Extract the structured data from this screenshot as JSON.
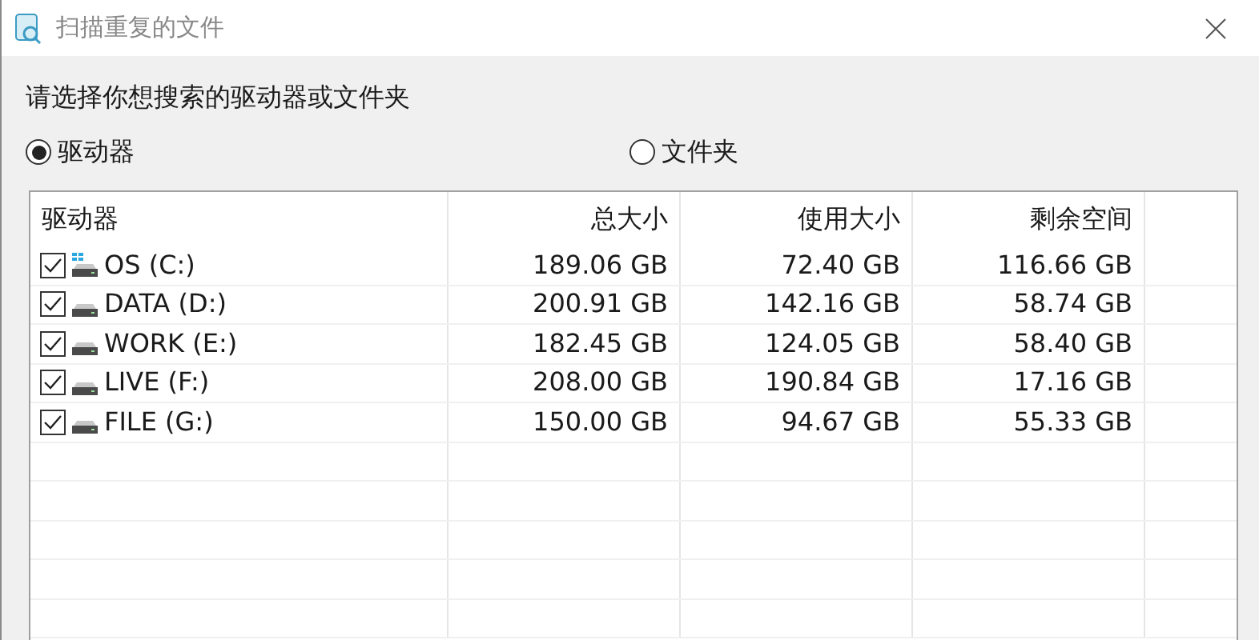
{
  "window": {
    "title": "扫描重复的文件"
  },
  "prompt": "请选择你想搜索的驱动器或文件夹",
  "options": [
    {
      "label": "驱动器",
      "selected": true
    },
    {
      "label": "文件夹",
      "selected": false
    }
  ],
  "table": {
    "columns": [
      "驱动器",
      "总大小",
      "使用大小",
      "剩余空间"
    ],
    "rows": [
      {
        "name": "OS (C:)",
        "kind": "system",
        "checked": true,
        "total": "189.06 GB",
        "used": "72.40 GB",
        "free": "116.66 GB"
      },
      {
        "name": "DATA (D:)",
        "kind": "drive",
        "checked": true,
        "total": "200.91 GB",
        "used": "142.16 GB",
        "free": "58.74 GB"
      },
      {
        "name": "WORK (E:)",
        "kind": "drive",
        "checked": true,
        "total": "182.45 GB",
        "used": "124.05 GB",
        "free": "58.40 GB"
      },
      {
        "name": "LIVE (F:)",
        "kind": "drive",
        "checked": true,
        "total": "208.00 GB",
        "used": "190.84 GB",
        "free": "17.16 GB"
      },
      {
        "name": "FILE (G:)",
        "kind": "drive",
        "checked": true,
        "total": "150.00 GB",
        "used": "94.67 GB",
        "free": "55.33 GB"
      }
    ]
  }
}
